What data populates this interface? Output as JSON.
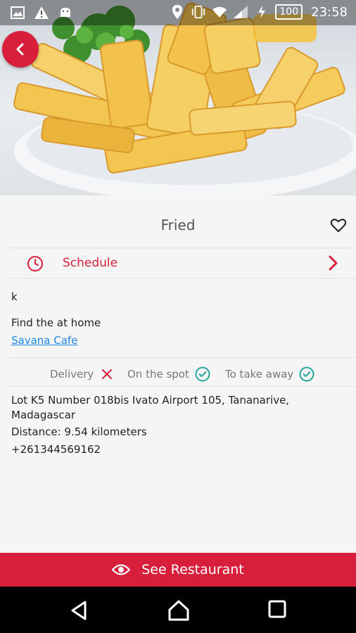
{
  "status_bar": {
    "time": "23:58",
    "battery": "100",
    "icons": [
      "image-icon",
      "warning-icon",
      "android-icon",
      "location-icon",
      "vibrate-icon",
      "wifi-icon",
      "signal-icon",
      "charging-icon"
    ]
  },
  "header": {
    "back_icon": "chevron-left-icon",
    "image": "french-fries-photo"
  },
  "item": {
    "title": "Fried",
    "favorite_icon": "heart-outline-icon"
  },
  "schedule": {
    "label": "Schedule",
    "icon": "clock-icon",
    "chevron": "chevron-right-icon"
  },
  "description": {
    "line1": "k",
    "line2": "Find the at home",
    "restaurant_link": "Savana Cafe"
  },
  "service_modes": [
    {
      "label": "Delivery",
      "available": false,
      "icon": "cross-icon"
    },
    {
      "label": "On the spot",
      "available": true,
      "icon": "check-circle-icon"
    },
    {
      "label": "To take away",
      "available": true,
      "icon": "check-circle-icon"
    }
  ],
  "restaurant_info": {
    "address": "Lot K5 Number 018bis Ivato Airport 105, Tananarive, Madagascar",
    "distance": "Distance: 9.54 kilometers",
    "phone": "+261344569162"
  },
  "cta": {
    "label": "See Restaurant",
    "icon": "eye-icon"
  },
  "nav": {
    "back": "back-triangle-icon",
    "home": "home-icon",
    "recents": "recents-square-icon"
  },
  "colors": {
    "accent": "#d71f3c",
    "link": "#1e88e5",
    "check": "#26a69a"
  }
}
